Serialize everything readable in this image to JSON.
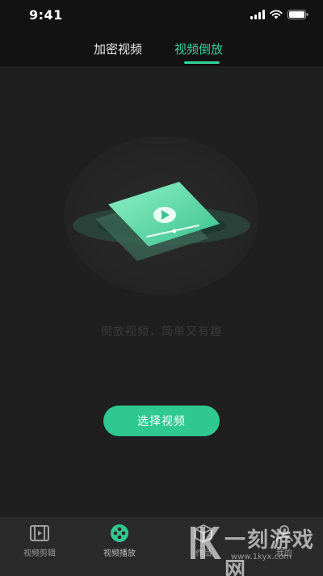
{
  "status_bar": {
    "time": "9:41"
  },
  "top_tabs": [
    {
      "label": "加密视频",
      "active": false
    },
    {
      "label": "视频倒放",
      "active": true
    }
  ],
  "main": {
    "slogan": "倒放视频，简单又有趣",
    "select_button": "选择视频"
  },
  "bottom_nav": [
    {
      "label": "视频剪辑",
      "icon": "film-icon",
      "active": false
    },
    {
      "label": "视频播放",
      "icon": "film-reel-icon",
      "active": true
    },
    {
      "label": "作品",
      "icon": "box-icon",
      "active": false
    },
    {
      "label": "我的",
      "icon": "user-icon",
      "active": false
    }
  ],
  "watermark": {
    "logo_text": "1K一刻游戏网",
    "url": "www.1kyx.com"
  },
  "colors": {
    "accent": "#35d49c",
    "button": "#2fc890",
    "background": "#1f1f1f",
    "nav_background": "#2a2a2a"
  }
}
